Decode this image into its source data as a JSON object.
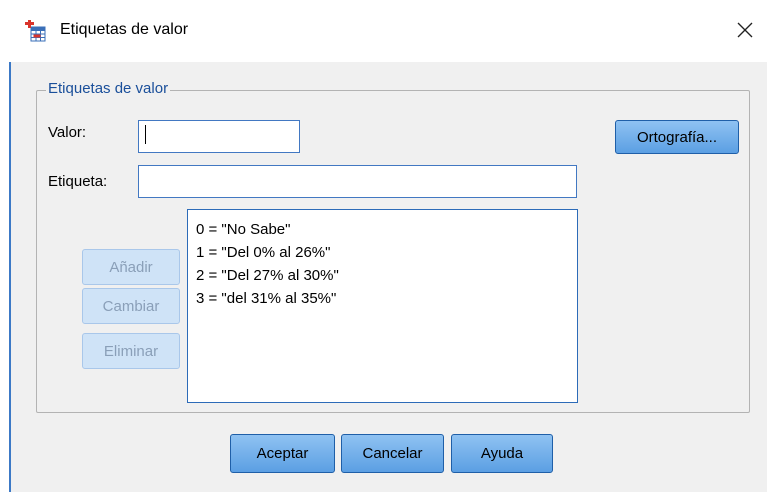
{
  "window": {
    "title": "Etiquetas de valor",
    "close_icon": "close-icon",
    "app_icon": "spss-table-icon"
  },
  "group": {
    "label": "Etiquetas de valor"
  },
  "form": {
    "valor_label": "Valor:",
    "valor_value": "",
    "etiqueta_label": "Etiqueta:",
    "etiqueta_value": ""
  },
  "buttons": {
    "ortografia": "Ortografía...",
    "anadir": "Añadir",
    "cambiar": "Cambiar",
    "eliminar": "Eliminar",
    "aceptar": "Aceptar",
    "cancelar": "Cancelar",
    "ayuda": "Ayuda"
  },
  "labels_list": [
    "0 = \"No Sabe\"",
    "1 = \"Del 0% al 26%\"",
    "2 = \"Del 27% al 30%\"",
    "3 = \"del 31% al 35%\""
  ],
  "colors": {
    "accent": "#3c79c6",
    "button": "#72aef0",
    "group_label": "#1a4f9a"
  }
}
